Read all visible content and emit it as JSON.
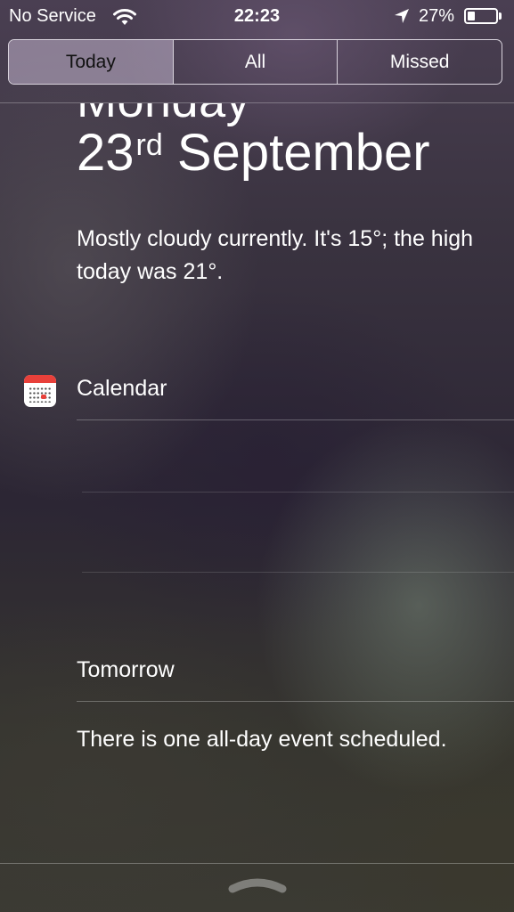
{
  "status_bar": {
    "carrier": "No Service",
    "time": "22:23",
    "battery_percent": "27%",
    "battery_level": 0.27,
    "wifi_icon": "wifi-icon",
    "location_icon": "location-arrow-icon",
    "battery_icon": "battery-icon"
  },
  "tabs": {
    "items": [
      {
        "label": "Today",
        "selected": true
      },
      {
        "label": "All",
        "selected": false
      },
      {
        "label": "Missed",
        "selected": false
      }
    ]
  },
  "today": {
    "day": "Monday",
    "date_number": "23",
    "date_suffix": "rd",
    "date_month": "September",
    "weather": "Mostly cloudy currently. It's 15°; the high today was 21°."
  },
  "calendar": {
    "icon": "calendar-app-icon",
    "title": "Calendar",
    "tomorrow_label": "Tomorrow",
    "tomorrow_text": "There is one all-day event scheduled."
  },
  "grabber": {
    "icon": "chevron-up-handle-icon"
  },
  "colors": {
    "selected_tab_bg": "#c3b4cd",
    "calendar_red": "#e8403a"
  }
}
